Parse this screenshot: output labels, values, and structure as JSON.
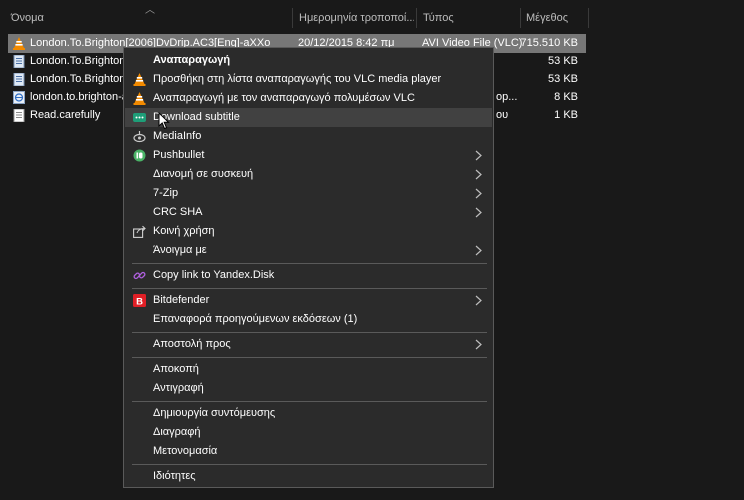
{
  "header": {
    "name": "Όνομα",
    "date": "Ημερομηνία τροποποί...",
    "type": "Τύπος",
    "size": "Μέγεθος"
  },
  "files": [
    {
      "name": "London.To.Brighton[2006]DvDrip.AC3[Eng]-aXXo",
      "date": "20/12/2015 8:42 πμ",
      "type": "AVI Video File (VLC)",
      "size": "715.510 KB",
      "icon": "vlc-cone-icon"
    },
    {
      "name": "London.To.Brighton[",
      "date": "",
      "type": "",
      "size": "53 KB",
      "icon": "text-document-icon"
    },
    {
      "name": "London.To.Brighton[",
      "date": "",
      "type": "",
      "size": "53 KB",
      "icon": "text-document-icon"
    },
    {
      "name": "london.to.brighton-a",
      "date": "",
      "type": "op...",
      "size": "8 KB",
      "icon": "web-shortcut-icon"
    },
    {
      "name": "Read.carefully",
      "date": "",
      "type": "ου",
      "size": "1 KB",
      "icon": "plain-text-icon"
    }
  ],
  "menu": {
    "play": "Αναπαραγωγή",
    "add_to_playlist": "Προσθήκη στη λίστα αναπαραγωγής του VLC media player",
    "play_with_vlc": "Αναπαραγωγή με τον αναπαραγωγό πολυμέσων VLC",
    "download_subtitle": "Download subtitle",
    "mediainfo": "MediaInfo",
    "pushbullet": "Pushbullet",
    "share_device": "Διανομή σε συσκευή",
    "sevenzip": "7-Zip",
    "crc_sha": "CRC SHA",
    "share": "Κοινή χρήση",
    "open_with": "Άνοιγμα με",
    "yandex": "Copy link to Yandex.Disk",
    "bitdefender": "Bitdefender",
    "restore_versions": "Επαναφορά προηγούμενων εκδόσεων (1)",
    "send_to": "Αποστολή προς",
    "cut": "Αποκοπή",
    "copy": "Αντιγραφή",
    "create_shortcut": "Δημιουργία συντόμευσης",
    "delete": "Διαγραφή",
    "rename": "Μετονομασία",
    "properties": "Ιδιότητες"
  },
  "colors": {
    "background": "#191919",
    "selected_row": "#777777",
    "menu_bg": "#2b2b2b",
    "menu_hover": "#414141",
    "vlc_orange": "#f28a00",
    "bitdefender_red": "#e01f26"
  }
}
